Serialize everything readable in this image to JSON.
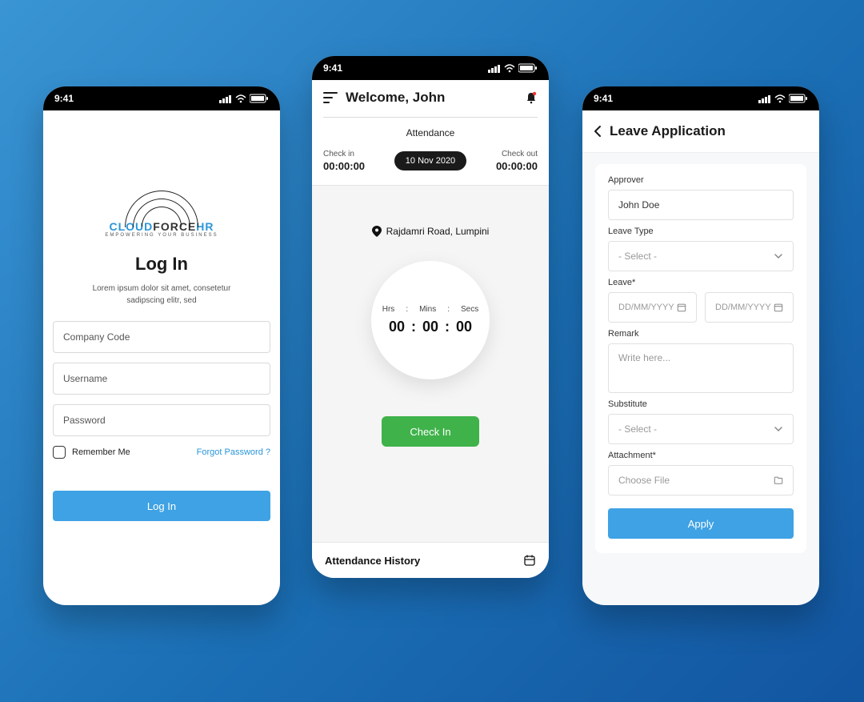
{
  "status": {
    "time": "9:41"
  },
  "login": {
    "brand_cloud": "CLOUD",
    "brand_force": "FORCE",
    "brand_hr": "HR",
    "brand_tagline": "EMPOWERING YOUR BUSINESS",
    "title": "Log In",
    "description": "Lorem ipsum dolor sit amet, consetetur sadipscing elitr, sed",
    "company_placeholder": "Company Code",
    "username_placeholder": "Username",
    "password_placeholder": "Password",
    "remember_label": "Remember Me",
    "forgot_label": "Forgot Password ?",
    "submit_label": "Log In"
  },
  "attendance": {
    "welcome": "Welcome, John",
    "section_title": "Attendance",
    "checkin_label": "Check in",
    "checkin_value": "00:00:00",
    "date_badge": "10 Nov 2020",
    "checkout_label": "Check out",
    "checkout_value": "00:00:00",
    "location": "Rajdamri Road, Lumpini",
    "timer_h_label": "Hrs",
    "timer_m_label": "Mins",
    "timer_s_label": "Secs",
    "timer_h": "00",
    "timer_m": "00",
    "timer_s": "00",
    "checkin_button": "Check In",
    "history_label": "Attendance History"
  },
  "leave": {
    "title": "Leave Application",
    "approver_label": "Approver",
    "approver_value": "John Doe",
    "type_label": "Leave Type",
    "type_placeholder": "- Select -",
    "period_label": "Leave*",
    "date_placeholder": "DD/MM/YYYY",
    "remark_label": "Remark",
    "remark_placeholder": "Write here...",
    "substitute_label": "Substitute",
    "substitute_placeholder": "- Select -",
    "attachment_label": "Attachment*",
    "attachment_placeholder": "Choose File",
    "apply_label": "Apply"
  }
}
